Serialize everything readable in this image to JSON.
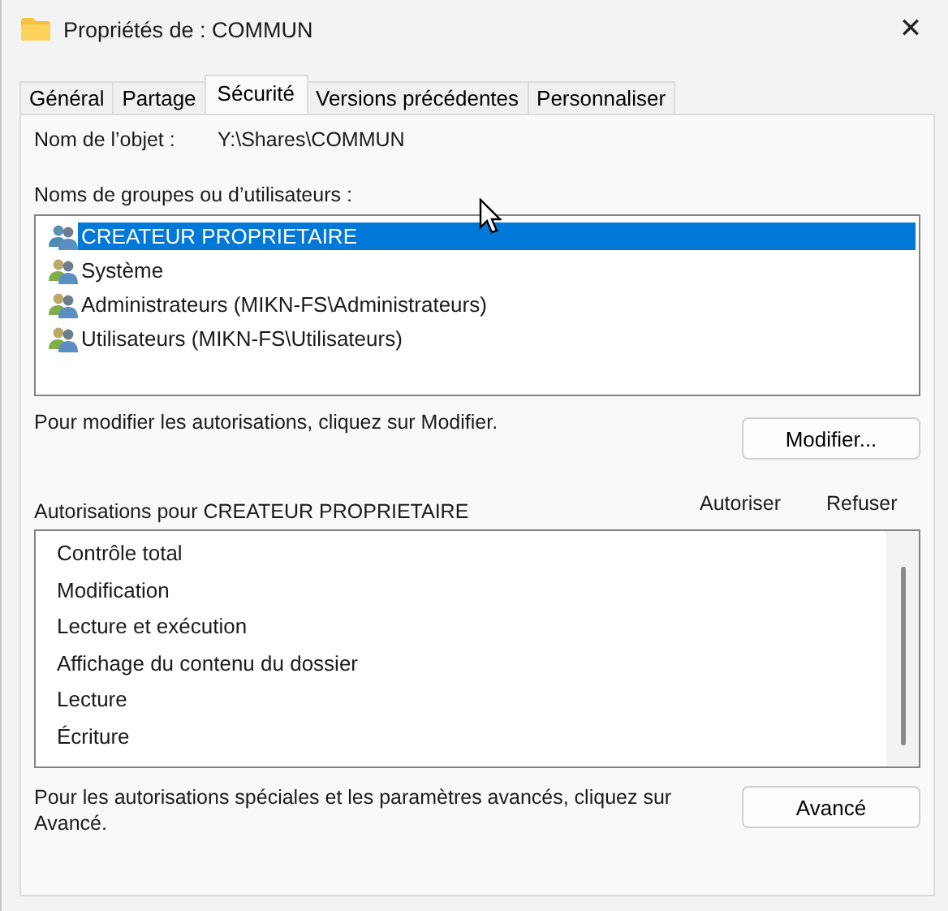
{
  "window": {
    "title": "Propriétés de : COMMUN",
    "close": "✕"
  },
  "tabs": [
    {
      "label": "Général",
      "selected": false
    },
    {
      "label": "Partage",
      "selected": false
    },
    {
      "label": "Sécurité",
      "selected": true
    },
    {
      "label": "Versions précédentes",
      "selected": false
    },
    {
      "label": "Personnaliser",
      "selected": false
    }
  ],
  "object": {
    "label": "Nom de l’objet :",
    "value": "Y:\\Shares\\COMMUN"
  },
  "groups": {
    "label": "Noms de groupes ou d’utilisateurs :",
    "items": [
      {
        "name": "CREATEUR PROPRIETAIRE",
        "selected": true
      },
      {
        "name": "Système",
        "selected": false
      },
      {
        "name": "Administrateurs (MIKN-FS\\Administrateurs)",
        "selected": false
      },
      {
        "name": "Utilisateurs (MIKN-FS\\Utilisateurs)",
        "selected": false
      }
    ]
  },
  "modify": {
    "text": "Pour modifier les autorisations, cliquez sur Modifier.",
    "button": "Modifier..."
  },
  "permissions": {
    "title": "Autorisations pour CREATEUR PROPRIETAIRE",
    "columns": [
      "Autoriser",
      "Refuser"
    ],
    "rows": [
      "Contrôle total",
      "Modification",
      "Lecture et exécution",
      "Affichage du contenu du dossier",
      "Lecture",
      "Écriture"
    ]
  },
  "advanced": {
    "text": "Pour les autorisations spéciales et les paramètres avancés, cliquez sur Avancé.",
    "button": "Avancé"
  }
}
